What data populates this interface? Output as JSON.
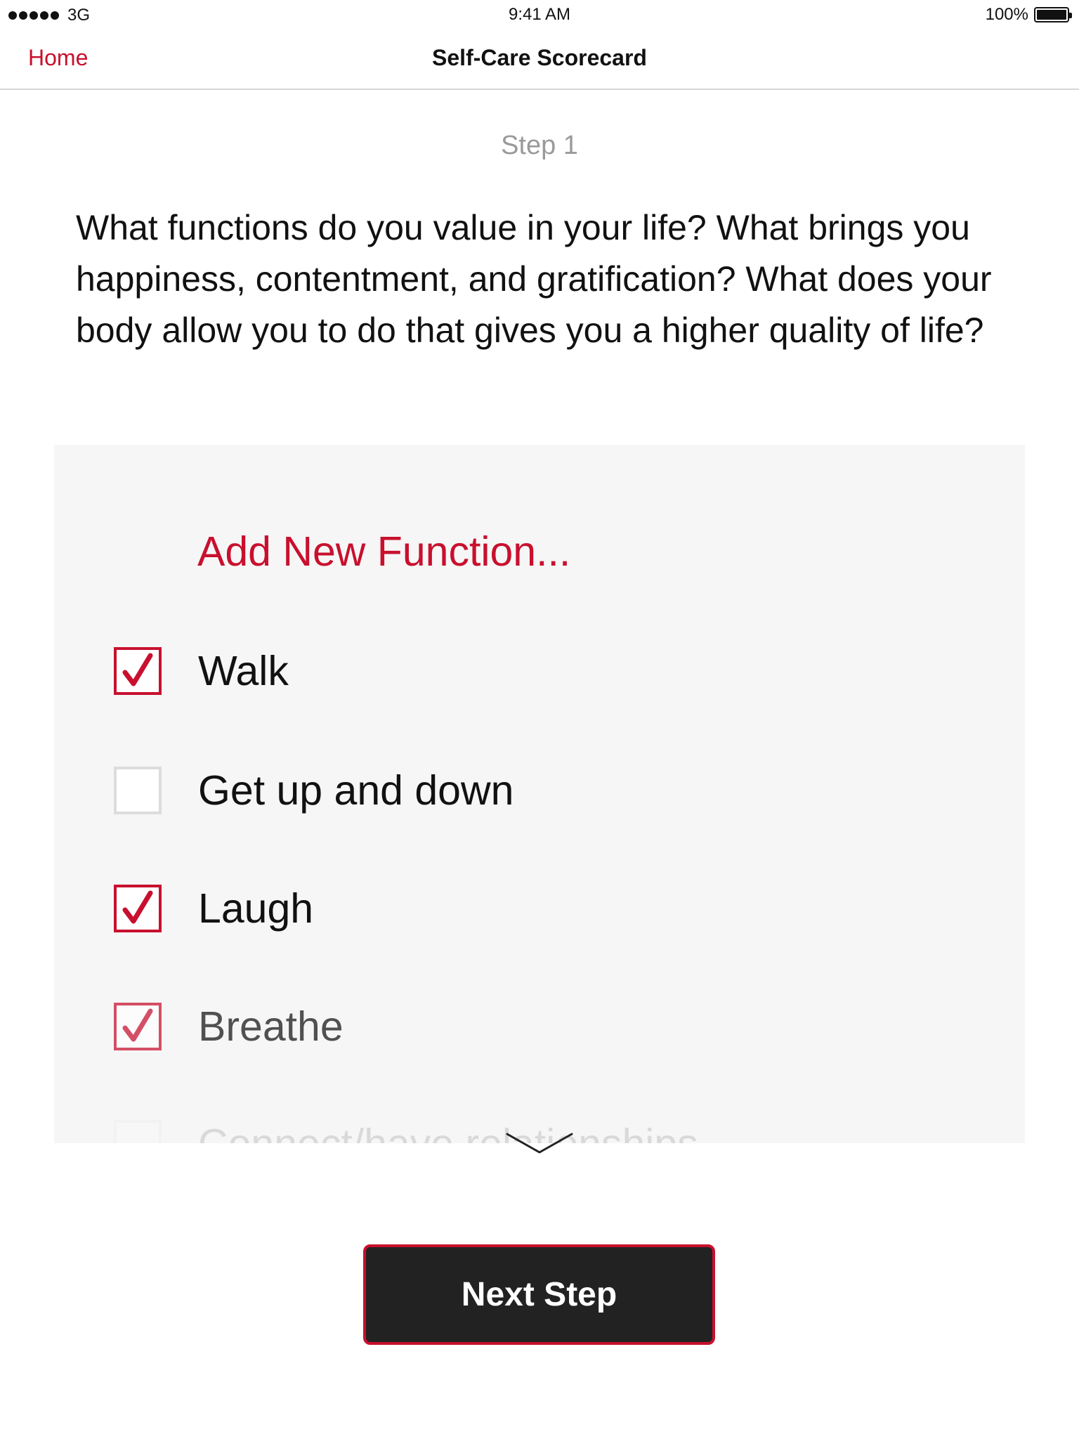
{
  "status_bar": {
    "carrier": "3G",
    "time": "9:41 AM",
    "battery": "100%",
    "battery_level": 1.0
  },
  "nav": {
    "back_label": "Home",
    "title": "Self-Care Scorecard"
  },
  "step": {
    "label": "Step 1",
    "question": "What functions do you value in your life? What brings you happiness, contentment, and gratification? What does your body allow you to do that gives you a higher quality of life?"
  },
  "list": {
    "add_label": "Add New Function...",
    "items": [
      {
        "label": "Walk",
        "checked": true
      },
      {
        "label": "Get up and down",
        "checked": false
      },
      {
        "label": "Laugh",
        "checked": true
      },
      {
        "label": "Breathe",
        "checked": true
      },
      {
        "label": "Connect/have relationships",
        "checked": false
      }
    ]
  },
  "actions": {
    "next_label": "Next Step"
  },
  "colors": {
    "accent": "#c8102e",
    "button_bg": "#222222",
    "panel_bg": "#f6f6f6",
    "muted_text": "#9a9a9a"
  },
  "icons": {
    "checkbox_checked": "checkmark-icon",
    "scroll_indicator": "chevron-down-icon"
  }
}
